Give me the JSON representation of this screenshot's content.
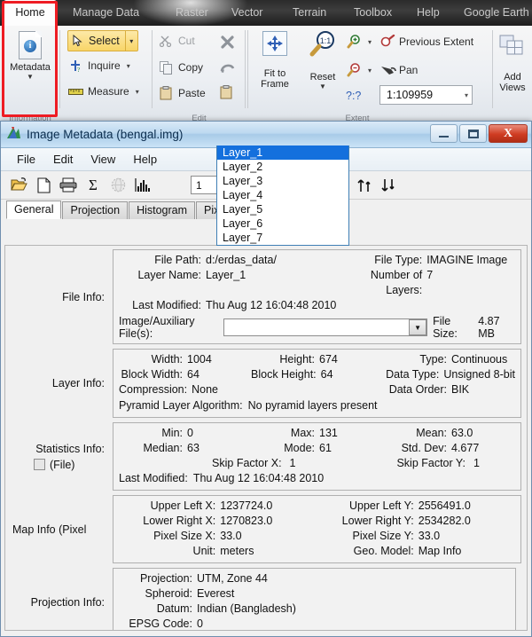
{
  "ribbon": {
    "tabs": [
      {
        "label": "Home",
        "active": true
      },
      {
        "label": "Manage Data",
        "active": false
      },
      {
        "label": "Raster",
        "active": false
      },
      {
        "label": "Vector",
        "active": false
      },
      {
        "label": "Terrain",
        "active": false
      },
      {
        "label": "Toolbox",
        "active": false
      },
      {
        "label": "Help",
        "active": false
      },
      {
        "label": "Google Earth",
        "active": false
      }
    ],
    "groups": [
      {
        "label": "Information"
      },
      {
        "label": "Edit"
      },
      {
        "label": "Extent"
      }
    ],
    "metadata_button": {
      "label": "Metadata",
      "caret": "▼"
    },
    "select_button": {
      "label": "Select",
      "caret": "▾"
    },
    "inquire_button": {
      "label": "Inquire",
      "caret": "▾"
    },
    "measure_button": {
      "label": "Measure",
      "caret": "▾"
    },
    "cut_button": {
      "label": "Cut"
    },
    "copy_button": {
      "label": "Copy"
    },
    "paste_button": {
      "label": "Paste"
    },
    "fit_to_frame": {
      "line1": "Fit to",
      "line2": "Frame"
    },
    "reset_button": {
      "label": "Reset",
      "caret": "▼"
    },
    "previous_extent": {
      "label": "Previous Extent"
    },
    "pan_button": {
      "label": "Pan"
    },
    "scale_help": {
      "label": "?:?"
    },
    "scale_box": {
      "value": "1:109959",
      "caret": "▾"
    },
    "add_views": {
      "line1": "Add",
      "line2": "Views"
    }
  },
  "window": {
    "title": "Image Metadata (bengal.img)",
    "minimize": "–",
    "maximize": "□",
    "close": "X",
    "menu": [
      "File",
      "Edit",
      "View",
      "Help"
    ],
    "toolbar": {
      "layer_spinner_value": "1",
      "spin_up": "▲",
      "spin_down": "▼",
      "layer_combo_value": "Layer_1",
      "layer_combo_caret": "▼",
      "layer_options": [
        "Layer_1",
        "Layer_2",
        "Layer_3",
        "Layer_4",
        "Layer_5",
        "Layer_6",
        "Layer_7"
      ],
      "layer_selected_index": 0
    },
    "tabs": [
      {
        "label": "General",
        "active": true
      },
      {
        "label": "Projection",
        "active": false
      },
      {
        "label": "Histogram",
        "active": false
      },
      {
        "label": "Pixel",
        "active": false
      }
    ]
  },
  "general": {
    "file_info": {
      "label": "File Info:",
      "file_path_key": "File Path:",
      "file_path_value": "d:/erdas_data/",
      "file_type_key": "File Type:",
      "file_type_value": "IMAGINE Image",
      "layer_name_key": "Layer Name:",
      "layer_name_value": "Layer_1",
      "num_layers_key": "Number of Layers:",
      "num_layers_value": "7",
      "last_modified_key": "Last Modified:",
      "last_modified_value": "Thu Aug 12 16:04:48 2010",
      "aux_files_key": "Image/Auxiliary File(s):",
      "aux_files_value": "",
      "aux_caret": "▼",
      "file_size_key": "File Size:",
      "file_size_value": "4.87 MB"
    },
    "layer_info": {
      "label": "Layer Info:",
      "fields": [
        {
          "k": "Width:",
          "v": "1004"
        },
        {
          "k": "Height:",
          "v": "674"
        },
        {
          "k": "Type:",
          "v": "Continuous"
        },
        {
          "k": "Block Width:",
          "v": "64"
        },
        {
          "k": "Block Height:",
          "v": "64"
        },
        {
          "k": "Data Type:",
          "v": "Unsigned 8-bit"
        },
        {
          "k": "Compression:",
          "v": "None"
        },
        {
          "k": "",
          "v": ""
        },
        {
          "k": "Data Order:",
          "v": "BIK"
        }
      ],
      "pyramid_key": "Pyramid Layer Algorithm:",
      "pyramid_value": "No pyramid layers present"
    },
    "statistics_info": {
      "label": "Statistics Info:",
      "file_checkbox_label": "(File)",
      "fields": [
        {
          "k": "Min:",
          "v": "0"
        },
        {
          "k": "Max:",
          "v": "131"
        },
        {
          "k": "Mean:",
          "v": "63.0"
        },
        {
          "k": "Median:",
          "v": "63"
        },
        {
          "k": "Mode:",
          "v": "61"
        },
        {
          "k": "Std. Dev:",
          "v": "4.677"
        }
      ],
      "skip_x_key": "Skip Factor X:",
      "skip_x_value": "1",
      "skip_y_key": "Skip Factor Y:",
      "skip_y_value": "1",
      "last_modified_key": "Last Modified:",
      "last_modified_value": "Thu Aug 12 16:04:48 2010"
    },
    "map_info": {
      "label": "Map Info (Pixel",
      "fields": [
        {
          "k": "Upper Left X:",
          "v": "1237724.0"
        },
        {
          "k": "Upper Left Y:",
          "v": "2556491.0"
        },
        {
          "k": "Lower Right X:",
          "v": "1270823.0"
        },
        {
          "k": "Lower Right Y:",
          "v": "2534282.0"
        },
        {
          "k": "Pixel Size X:",
          "v": "33.0"
        },
        {
          "k": "Pixel Size Y:",
          "v": "33.0"
        },
        {
          "k": "Unit:",
          "v": "meters"
        },
        {
          "k": "Geo. Model:",
          "v": "Map Info"
        }
      ]
    },
    "projection_info": {
      "label": "Projection Info:",
      "fields": [
        {
          "k": "Projection:",
          "v": "UTM, Zone 44"
        },
        {
          "k": "Spheroid:",
          "v": "Everest"
        },
        {
          "k": "Datum:",
          "v": "Indian (Bangladesh)"
        },
        {
          "k": "EPSG Code:",
          "v": "0"
        }
      ]
    }
  },
  "colors": {
    "highlight_red": "#ee1c23",
    "select_yellow": "#f8d568",
    "combo_blue": "#1470dd",
    "title_blue": "#a8cbe8"
  }
}
